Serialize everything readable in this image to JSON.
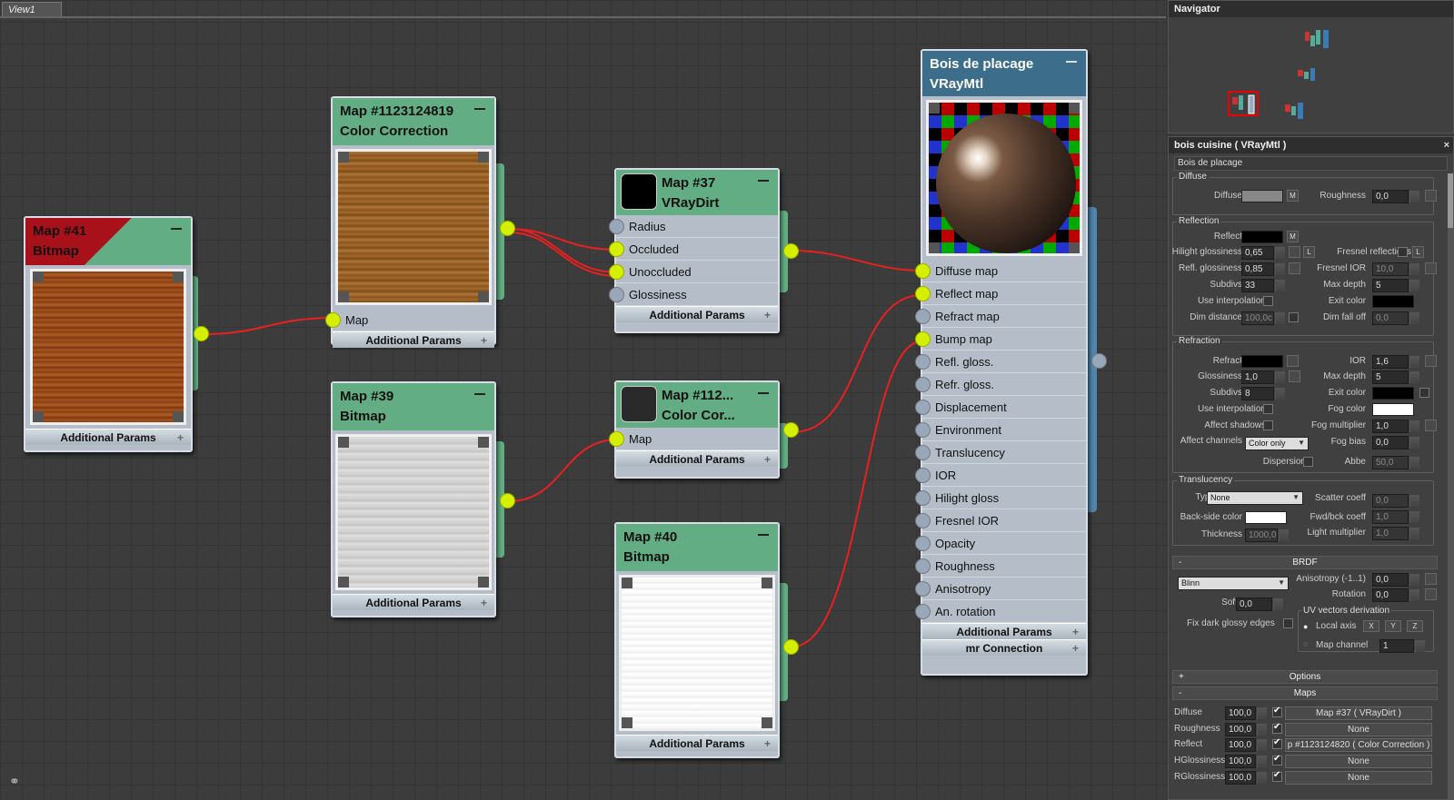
{
  "view": {
    "tab": "View1"
  },
  "nodes": {
    "n41": {
      "name": "Map #41",
      "type": "Bitmap",
      "footer": "Additional Params"
    },
    "ncc": {
      "name": "Map #1123124819",
      "type": "Color Correction",
      "port": "Map",
      "footer": "Additional Params"
    },
    "n39": {
      "name": "Map #39",
      "type": "Bitmap",
      "footer": "Additional Params"
    },
    "n37": {
      "name": "Map #37",
      "type": "VRayDirt",
      "ports": [
        "Radius",
        "Occluded",
        "Unoccluded",
        "Glossiness"
      ],
      "footer": "Additional Params"
    },
    "ncc2": {
      "name": "Map  #112...",
      "type": "Color  Cor...",
      "port": "Map",
      "footer": "Additional Params"
    },
    "n40": {
      "name": "Map #40",
      "type": "Bitmap",
      "footer": "Additional Params"
    },
    "mtl": {
      "name": "Bois de placage",
      "type": "VRayMtl",
      "ports": [
        "Diffuse map",
        "Reflect map",
        "Refract map",
        "Bump map",
        "Refl. gloss.",
        "Refr. gloss.",
        "Displacement",
        "Environment",
        "Translucency",
        "IOR",
        "Hilight gloss",
        "Fresnel IOR",
        "Opacity",
        "Roughness",
        "Anisotropy",
        "An. rotation"
      ],
      "footer": "Additional Params",
      "footer2": "mr Connection"
    }
  },
  "navigator": {
    "title": "Navigator"
  },
  "props": {
    "title": "bois cuisine  ( VRayMtl )",
    "name": "Bois de placage",
    "diffuse": {
      "group": "Diffuse",
      "diffuse": "Diffuse",
      "m": "M",
      "roughness": "Roughness",
      "roughness_val": "0,0"
    },
    "reflection": {
      "group": "Reflection",
      "reflect": "Reflect",
      "m": "M",
      "hilight": "Hilight glossiness",
      "hilight_val": "0,65",
      "l": "L",
      "fresnel": "Fresnel reflections",
      "refl_gloss": "Refl. glossiness",
      "refl_gloss_val": "0,85",
      "fresnel_ior": "Fresnel IOR",
      "fresnel_ior_val": "10,0",
      "subdivs": "Subdivs",
      "subdivs_val": "33",
      "max_depth": "Max depth",
      "max_depth_val": "5",
      "use_interp": "Use interpolation",
      "exit_color": "Exit color",
      "dim_dist": "Dim distance",
      "dim_dist_val": "100,0c",
      "dim_falloff": "Dim fall off",
      "dim_falloff_val": "0,0"
    },
    "refraction": {
      "group": "Refraction",
      "refract": "Refract",
      "ior": "IOR",
      "ior_val": "1,6",
      "gloss": "Glossiness",
      "gloss_val": "1,0",
      "max_depth": "Max depth",
      "max_depth_val": "5",
      "subdivs": "Subdivs",
      "subdivs_val": "8",
      "exit_color": "Exit color",
      "use_interp": "Use interpolation",
      "fog_color": "Fog color",
      "affect_shadows": "Affect shadows",
      "fog_mult": "Fog multiplier",
      "fog_mult_val": "1,0",
      "affect_channels": "Affect channels",
      "affect_channels_val": "Color only",
      "fog_bias": "Fog bias",
      "fog_bias_val": "0,0",
      "dispersion": "Dispersion",
      "abbe": "Abbe",
      "abbe_val": "50,0"
    },
    "translucency": {
      "group": "Translucency",
      "type": "Type",
      "type_val": "None",
      "scatter": "Scatter coeff",
      "scatter_val": "0,0",
      "backside": "Back-side color",
      "fwd": "Fwd/bck coeff",
      "fwd_val": "1,0",
      "thickness": "Thickness",
      "thickness_val": "1000,0",
      "light_mult": "Light multiplier",
      "light_mult_val": "1,0"
    },
    "brdf": {
      "title": "BRDF",
      "sign": "-",
      "type_val": "Blinn",
      "aniso": "Anisotropy (-1..1)",
      "aniso_val": "0,0",
      "rotation": "Rotation",
      "rotation_val": "0,0",
      "soften": "Soften",
      "soften_val": "0,0",
      "uv_group": "UV vectors derivation",
      "fix_dark": "Fix dark glossy edges",
      "local_axis": "Local axis",
      "x": "X",
      "y": "Y",
      "z": "Z",
      "map_channel": "Map channel",
      "map_channel_val": "1"
    },
    "options": {
      "title": "Options",
      "sign": "+"
    },
    "maps": {
      "title": "Maps",
      "sign": "-",
      "rows": [
        {
          "label": "Diffuse",
          "amount": "100,0",
          "map": "Map #37  ( VRayDirt )"
        },
        {
          "label": "Roughness",
          "amount": "100,0",
          "map": "None"
        },
        {
          "label": "Reflect",
          "amount": "100,0",
          "map": "p #1123124820  ( Color Correction )"
        },
        {
          "label": "HGlossiness",
          "amount": "100,0",
          "map": "None"
        },
        {
          "label": "RGlossiness",
          "amount": "100,0",
          "map": "None"
        }
      ]
    }
  },
  "colors": {
    "node_header": "#62ad84",
    "active_port": "#d4f000",
    "wire": "#e82020",
    "material_header": "#3c6e8c",
    "error_header": "#a8101a"
  }
}
